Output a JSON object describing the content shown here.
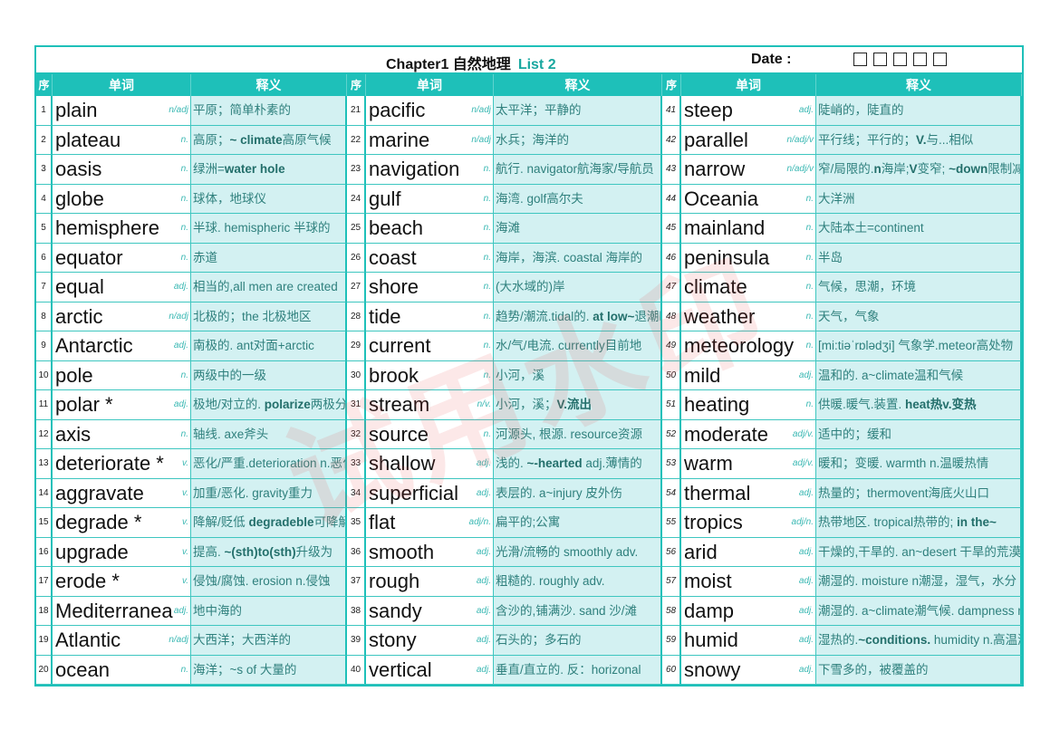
{
  "header": {
    "title": "Chapter1 自然地理",
    "list": "List 2",
    "date_label": "Date :",
    "checkbox_count": 5
  },
  "columns": {
    "num": "序",
    "word": "单词",
    "def": "释义"
  },
  "colors": {
    "accent": "#1ec0b9",
    "def_bg": "#d3f1f2",
    "def_text": "#2f807d",
    "watermark": "#eb5050"
  },
  "watermark": "试用水印",
  "entries": [
    {
      "n": "1",
      "w": "plain",
      "p": "n/adj",
      "d": [
        {
          "t": "平原；简单朴素的"
        }
      ]
    },
    {
      "n": "2",
      "w": "plateau",
      "p": "n.",
      "d": [
        {
          "t": "高原；"
        },
        {
          "t": "~ climate",
          "b": 1
        },
        {
          "t": "高原气候"
        }
      ]
    },
    {
      "n": "3",
      "w": "oasis",
      "p": "n.",
      "d": [
        {
          "t": "绿洲="
        },
        {
          "t": "water hole",
          "b": 1
        }
      ]
    },
    {
      "n": "4",
      "w": "globe",
      "p": "n.",
      "d": [
        {
          "t": "球体，地球仪"
        }
      ]
    },
    {
      "n": "5",
      "w": "hemisphere",
      "p": "n.",
      "d": [
        {
          "t": "半球. hemispheric 半球的"
        }
      ]
    },
    {
      "n": "6",
      "w": "equator",
      "p": "n.",
      "d": [
        {
          "t": "赤道"
        }
      ]
    },
    {
      "n": "7",
      "w": "equal",
      "p": "adj.",
      "d": [
        {
          "t": "相当的,all men are created"
        }
      ]
    },
    {
      "n": "8",
      "w": "arctic",
      "p": "n/adj",
      "d": [
        {
          "t": "北极的；the 北极地区"
        }
      ]
    },
    {
      "n": "9",
      "w": "Antarctic",
      "p": "adj.",
      "d": [
        {
          "t": "南极的. ant对面+arctic"
        }
      ]
    },
    {
      "n": "10",
      "w": "pole",
      "p": "n.",
      "d": [
        {
          "t": "两级中的一级"
        }
      ]
    },
    {
      "n": "11",
      "w": "polar *",
      "p": "adj.",
      "d": [
        {
          "t": "极地/对立的. "
        },
        {
          "t": "polarize",
          "b": 1
        },
        {
          "t": "两极分化"
        }
      ]
    },
    {
      "n": "12",
      "w": "axis",
      "p": "n.",
      "d": [
        {
          "t": "轴线. axe斧头"
        }
      ]
    },
    {
      "n": "13",
      "w": "deteriorate *",
      "p": "v.",
      "d": [
        {
          "t": "恶化/严重.deterioration n.恶化"
        }
      ]
    },
    {
      "n": "14",
      "w": "aggravate",
      "p": "v.",
      "d": [
        {
          "t": "加重/恶化. gravity重力"
        }
      ]
    },
    {
      "n": "15",
      "w": "degrade *",
      "p": "v.",
      "d": [
        {
          "t": "降解/贬低 "
        },
        {
          "t": "degradeble",
          "b": 1
        },
        {
          "t": "可降解"
        }
      ]
    },
    {
      "n": "16",
      "w": "upgrade",
      "p": "v.",
      "d": [
        {
          "t": "提高. "
        },
        {
          "t": "~(sth)to(sth)",
          "b": 1
        },
        {
          "t": "升级为"
        }
      ]
    },
    {
      "n": "17",
      "w": "erode *",
      "p": "v.",
      "d": [
        {
          "t": "侵蚀/腐蚀. erosion n.侵蚀"
        }
      ]
    },
    {
      "n": "18",
      "w": "Mediterranean",
      "p": "adj.",
      "d": [
        {
          "t": "地中海的"
        }
      ]
    },
    {
      "n": "19",
      "w": "Atlantic",
      "p": "n/adj",
      "d": [
        {
          "t": "大西洋；大西洋的"
        }
      ]
    },
    {
      "n": "20",
      "w": "ocean",
      "p": "n.",
      "d": [
        {
          "t": "海洋；~s of 大量的"
        }
      ]
    },
    {
      "n": "21",
      "w": "pacific",
      "p": "n/adj",
      "d": [
        {
          "t": "太平洋；平静的"
        }
      ]
    },
    {
      "n": "22",
      "w": "marine",
      "p": "n/adj",
      "d": [
        {
          "t": "水兵；海洋的"
        }
      ]
    },
    {
      "n": "23",
      "w": "navigation",
      "p": "n.",
      "d": [
        {
          "t": "航行. navigator航海家/导航员"
        }
      ]
    },
    {
      "n": "24",
      "w": "gulf",
      "p": "n.",
      "d": [
        {
          "t": "海湾. golf高尔夫"
        }
      ]
    },
    {
      "n": "25",
      "w": "beach",
      "p": "n.",
      "d": [
        {
          "t": "海滩"
        }
      ]
    },
    {
      "n": "26",
      "w": "coast",
      "p": "n.",
      "d": [
        {
          "t": "海岸，海滨.  coastal 海岸的"
        }
      ]
    },
    {
      "n": "27",
      "w": "shore",
      "p": "n.",
      "d": [
        {
          "t": "(大水域的)岸"
        }
      ]
    },
    {
      "n": "28",
      "w": "tide",
      "p": "n.",
      "d": [
        {
          "t": "趋势/潮流.tidal的. "
        },
        {
          "t": "at low~",
          "b": 1
        },
        {
          "t": "退潮时"
        }
      ]
    },
    {
      "n": "29",
      "w": "current",
      "p": "n.",
      "d": [
        {
          "t": "水/气/电流. currently目前地"
        }
      ]
    },
    {
      "n": "30",
      "w": "brook",
      "p": "n.",
      "d": [
        {
          "t": "小河，溪"
        }
      ]
    },
    {
      "n": "31",
      "w": "stream",
      "p": "n/v.",
      "d": [
        {
          "t": "小河，溪；"
        },
        {
          "t": "V.流出",
          "b": 1
        }
      ]
    },
    {
      "n": "32",
      "w": "source",
      "p": "n.",
      "d": [
        {
          "t": "河源头, 根源. resource资源"
        }
      ]
    },
    {
      "n": "33",
      "w": "shallow",
      "p": "adj.",
      "d": [
        {
          "t": "浅的. "
        },
        {
          "t": "~-hearted",
          "b": 1
        },
        {
          "t": " adj.薄情的"
        }
      ]
    },
    {
      "n": "34",
      "w": "superficial",
      "p": "adj.",
      "d": [
        {
          "t": "表层的. a~injury 皮外伤"
        }
      ]
    },
    {
      "n": "35",
      "w": "flat",
      "p": "adj/n.",
      "d": [
        {
          "t": "扁平的;公寓"
        }
      ]
    },
    {
      "n": "36",
      "w": "smooth",
      "p": "adj.",
      "d": [
        {
          "t": "光滑/流畅的 smoothly adv."
        }
      ]
    },
    {
      "n": "37",
      "w": "rough",
      "p": "adj.",
      "d": [
        {
          "t": "粗糙的. roughly adv."
        }
      ]
    },
    {
      "n": "38",
      "w": "sandy",
      "p": "adj.",
      "d": [
        {
          "t": "含沙的,铺满沙. sand 沙/滩"
        }
      ]
    },
    {
      "n": "39",
      "w": "stony",
      "p": "adj.",
      "d": [
        {
          "t": "石头的；多石的"
        }
      ]
    },
    {
      "n": "40",
      "w": "vertical",
      "p": "adj.",
      "d": [
        {
          "t": "垂直/直立的. 反：horizonal"
        }
      ]
    },
    {
      "n": "41",
      "w": "steep",
      "p": "adj.",
      "d": [
        {
          "t": "陡峭的，陡直的"
        }
      ]
    },
    {
      "n": "42",
      "w": "parallel",
      "p": "n/adj/v",
      "d": [
        {
          "t": "平行线；平行的；"
        },
        {
          "t": "V.",
          "b": 1
        },
        {
          "t": "与...相似"
        }
      ]
    },
    {
      "n": "43",
      "w": "narrow",
      "p": "n/adj/v",
      "d": [
        {
          "t": "窄/局限的."
        },
        {
          "t": "n",
          "b": 1
        },
        {
          "t": "海岸;"
        },
        {
          "t": "V",
          "b": 1
        },
        {
          "t": "变窄; "
        },
        {
          "t": "~down",
          "b": 1
        },
        {
          "t": "限制减少"
        }
      ]
    },
    {
      "n": "44",
      "w": "Oceania",
      "p": "n.",
      "d": [
        {
          "t": "大洋洲"
        }
      ]
    },
    {
      "n": "45",
      "w": "mainland",
      "p": "n.",
      "d": [
        {
          "t": "大陆本土=continent"
        }
      ]
    },
    {
      "n": "46",
      "w": "peninsula",
      "p": "n.",
      "d": [
        {
          "t": "半岛"
        }
      ]
    },
    {
      "n": "47",
      "w": "climate",
      "p": "n.",
      "d": [
        {
          "t": "气候，思潮，环境"
        }
      ]
    },
    {
      "n": "48",
      "w": "weather",
      "p": "n.",
      "d": [
        {
          "t": "天气，气象"
        }
      ]
    },
    {
      "n": "49",
      "w": "meteorology",
      "p": "n.",
      "d": [
        {
          "t": "[mi:tiəˈrɒlədʒi] 气象学.meteor高处物"
        }
      ]
    },
    {
      "n": "50",
      "w": "mild",
      "p": "adj.",
      "d": [
        {
          "t": "温和的. a~climate温和气候"
        }
      ]
    },
    {
      "n": "51",
      "w": "heating",
      "p": "n.",
      "d": [
        {
          "t": "供暖.暖气.装置. "
        },
        {
          "t": "heat热v.变热",
          "b": 1
        }
      ]
    },
    {
      "n": "52",
      "w": "moderate",
      "p": "adj/v.",
      "d": [
        {
          "t": "适中的；缓和"
        }
      ]
    },
    {
      "n": "53",
      "w": "warm",
      "p": "adj/v.",
      "d": [
        {
          "t": "暖和；变暖. warmth n.温暖热情"
        }
      ]
    },
    {
      "n": "54",
      "w": "thermal",
      "p": "adj.",
      "d": [
        {
          "t": "热量的；thermovent海底火山口"
        }
      ]
    },
    {
      "n": "55",
      "w": "tropics",
      "p": "adj/n.",
      "d": [
        {
          "t": "热带地区. tropical热带的; "
        },
        {
          "t": "in the~",
          "b": 1
        }
      ]
    },
    {
      "n": "56",
      "w": "arid",
      "p": "adj.",
      "d": [
        {
          "t": "干燥的,干旱的. an~desert 干旱的荒漠"
        }
      ]
    },
    {
      "n": "57",
      "w": "moist",
      "p": "adj.",
      "d": [
        {
          "t": "潮湿的. moisture n潮湿，湿气，水分"
        }
      ]
    },
    {
      "n": "58",
      "w": "damp",
      "p": "adj.",
      "d": [
        {
          "t": "潮湿的. a~climate潮气候. dampness n."
        }
      ]
    },
    {
      "n": "59",
      "w": "humid",
      "p": "adj.",
      "d": [
        {
          "t": "湿热的."
        },
        {
          "t": "~conditions.",
          "b": 1
        },
        {
          "t": " humidity n.高温潮"
        }
      ]
    },
    {
      "n": "60",
      "w": "snowy",
      "p": "adj.",
      "d": [
        {
          "t": "下雪多的，被覆盖的"
        }
      ]
    }
  ]
}
